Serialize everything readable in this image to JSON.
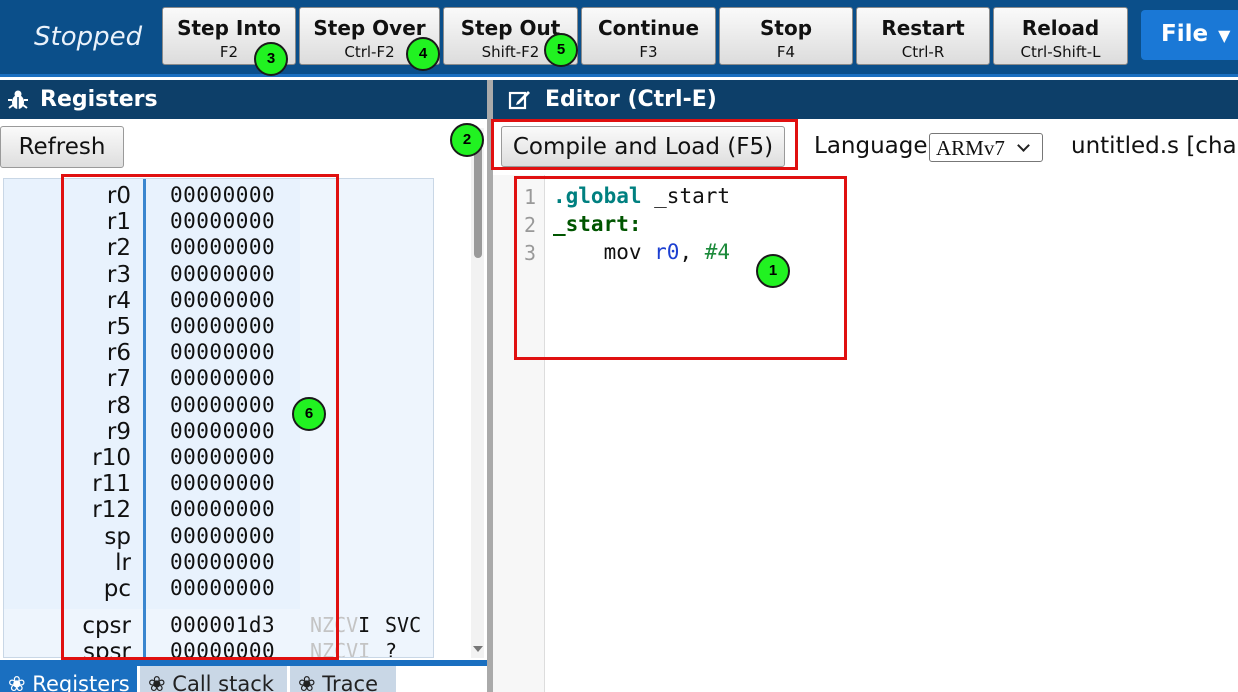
{
  "toolbar": {
    "status": "Stopped",
    "buttons": [
      {
        "label": "Step Into",
        "key": "F2"
      },
      {
        "label": "Step Over",
        "key": "Ctrl-F2"
      },
      {
        "label": "Step Out",
        "key": "Shift-F2"
      },
      {
        "label": "Continue",
        "key": "F3"
      },
      {
        "label": "Stop",
        "key": "F4"
      },
      {
        "label": "Restart",
        "key": "Ctrl-R"
      },
      {
        "label": "Reload",
        "key": "Ctrl-Shift-L"
      }
    ],
    "file_label": "File"
  },
  "registers_panel": {
    "title": "Registers",
    "refresh_label": "Refresh",
    "registers": [
      {
        "name": "r0",
        "value": "00000000"
      },
      {
        "name": "r1",
        "value": "00000000"
      },
      {
        "name": "r2",
        "value": "00000000"
      },
      {
        "name": "r3",
        "value": "00000000"
      },
      {
        "name": "r4",
        "value": "00000000"
      },
      {
        "name": "r5",
        "value": "00000000"
      },
      {
        "name": "r6",
        "value": "00000000"
      },
      {
        "name": "r7",
        "value": "00000000"
      },
      {
        "name": "r8",
        "value": "00000000"
      },
      {
        "name": "r9",
        "value": "00000000"
      },
      {
        "name": "r10",
        "value": "00000000"
      },
      {
        "name": "r11",
        "value": "00000000"
      },
      {
        "name": "r12",
        "value": "00000000"
      },
      {
        "name": "sp",
        "value": "00000000"
      },
      {
        "name": "lr",
        "value": "00000000"
      },
      {
        "name": "pc",
        "value": "00000000"
      }
    ],
    "status_registers": [
      {
        "name": "cpsr",
        "value": "000001d3",
        "flags_off": "NZCV",
        "flags_on": "I",
        "mode": "SVC"
      },
      {
        "name": "spsr",
        "value": "00000000",
        "flags_off": "NZCVI",
        "flags_on": "",
        "mode": "?"
      }
    ],
    "tabs": [
      "Registers",
      "Call stack",
      "Trace"
    ]
  },
  "editor": {
    "title": "Editor (Ctrl-E)",
    "compile_label": "Compile and Load (F5)",
    "language_label": "Language:",
    "language_value": "ARMv7",
    "filename": "untitled.s [changed]",
    "line_numbers": [
      "1",
      "2",
      "3"
    ],
    "code": {
      "l1_directive": ".global",
      "l1_rest": " _start",
      "l2_label": "_start:",
      "l3_indent": "    mov ",
      "l3_reg": "r0",
      "l3_comma": ", ",
      "l3_imm": "#4"
    }
  },
  "annotations": {
    "markers": [
      "1",
      "2",
      "3",
      "4",
      "5",
      "6"
    ]
  },
  "colors": {
    "toolbar_bg": "#0b4f8a",
    "header_bg": "#0d3f69",
    "accent": "#1a78d6",
    "highlight": "#e01010",
    "marker": "#21f221"
  }
}
